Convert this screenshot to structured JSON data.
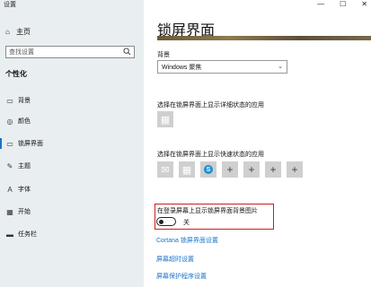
{
  "window": {
    "title": "设置",
    "controls": {
      "minimize": "—",
      "maximize": "☐",
      "close": "✕"
    }
  },
  "sidebar": {
    "home": {
      "icon": "home-icon",
      "label": "主页"
    },
    "search": {
      "placeholder": "查找设置"
    },
    "section_title": "个性化",
    "items": [
      {
        "icon": "image-icon",
        "label": "背景"
      },
      {
        "icon": "palette-icon",
        "label": "颜色"
      },
      {
        "icon": "monitor-icon",
        "label": "锁屏界面"
      },
      {
        "icon": "brush-icon",
        "label": "主题"
      },
      {
        "icon": "font-icon",
        "label": "字体"
      },
      {
        "icon": "start-icon",
        "label": "开始"
      },
      {
        "icon": "taskbar-icon",
        "label": "任务栏"
      }
    ],
    "active_index": 2
  },
  "main": {
    "title": "锁屏界面",
    "background_label": "背景",
    "background_select": "Windows 聚焦",
    "detailed_status_label": "选择在锁屏界面上显示详细状态的应用",
    "quick_status_label": "选择在锁屏界面上显示快速状态的应用",
    "signin_bg_label": "在登录屏幕上显示锁屏界面背景图片",
    "signin_bg_state": "关",
    "links": {
      "cortana": "Cortana 锁屏界面设置",
      "timeout": "屏幕超时设置",
      "screensaver": "屏幕保护程序设置"
    }
  },
  "colors": {
    "accent": "#1a73c8",
    "highlight_box": "#d21a1a"
  }
}
